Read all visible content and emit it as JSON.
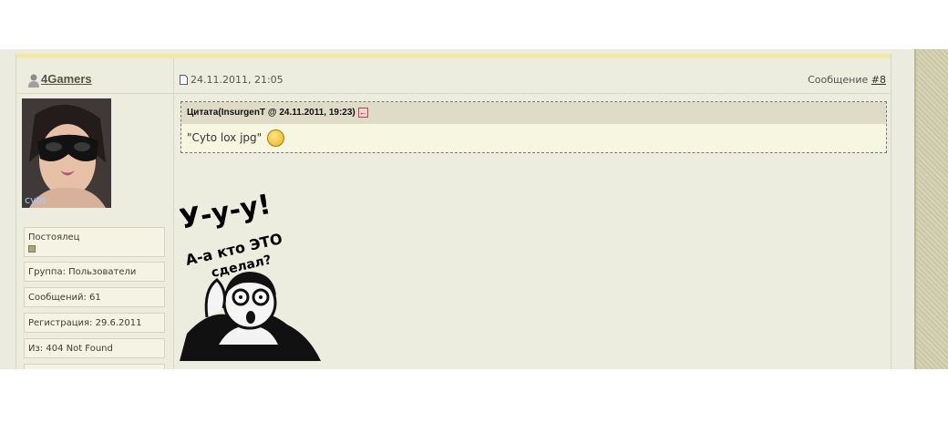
{
  "post": {
    "username": "4Gamers",
    "date": "24.11.2011, 21:05",
    "post_number_label": "Сообщение",
    "post_number": "#8",
    "user_info": {
      "rank": "Постоялец",
      "group": "Группа: Пользователи",
      "messages": "Сообщений: 61",
      "registration": "Регистрация: 29.6.2011",
      "location": "Из: 404 Not Found"
    },
    "quote": {
      "header": "Цитата(InsurgenT @ 24.11.2011, 19:23)",
      "text": "\"Cyto lox jpg\""
    },
    "meme": {
      "line1": "У-у-у!",
      "line2": "А-а кто ЭТО",
      "line3": "сделал?"
    }
  },
  "colors": {
    "header_accent": "#f2e7a3",
    "panel_bg": "#ececdf",
    "quote_bg": "#f7f6e1"
  },
  "icons": [
    "user-icon",
    "document-icon",
    "quote-source-icon",
    "smiley-icon"
  ]
}
